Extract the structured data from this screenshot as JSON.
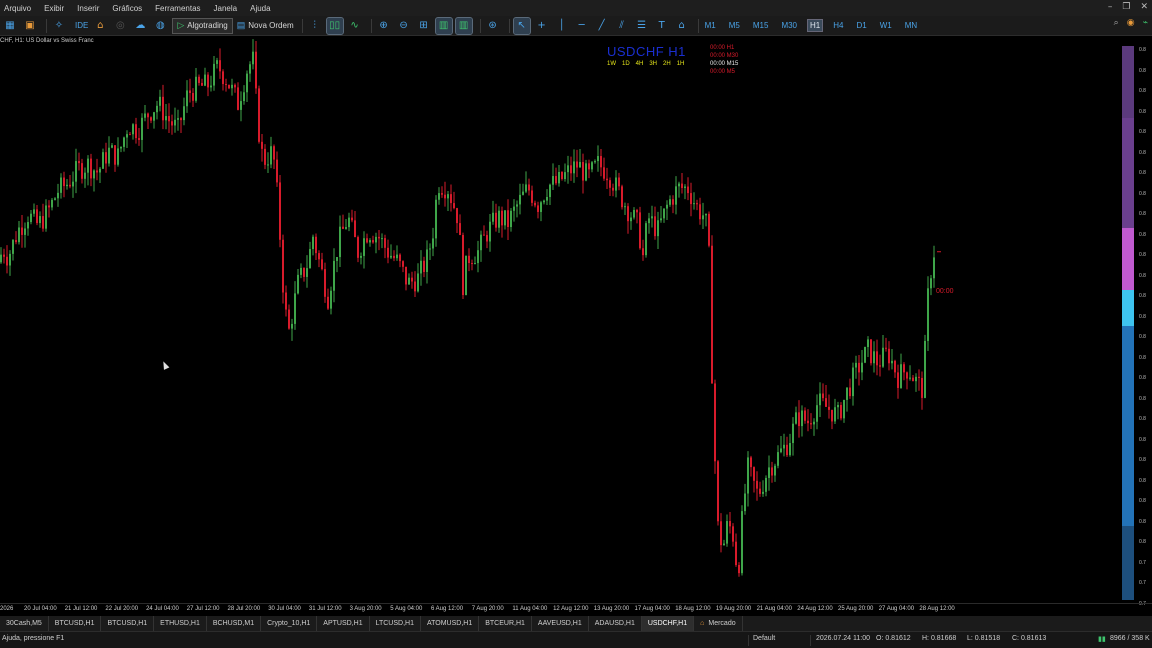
{
  "menu": [
    "Arquivo",
    "Exibir",
    "Inserir",
    "Gráficos",
    "Ferramentas",
    "Janela",
    "Ajuda"
  ],
  "toolbar": {
    "ide_label": "IDE",
    "algotrading_label": "Algotrading",
    "new_order_label": "Nova Ordem"
  },
  "timeframes": [
    "M1",
    "M5",
    "M15",
    "M30",
    "H1",
    "H4",
    "D1",
    "W1",
    "MN"
  ],
  "active_timeframe": "H1",
  "chart": {
    "title": "CHF, H1:  US Dollar vs Swiss Franc",
    "symbol_label": "USDCHF H1",
    "tf_buttons": [
      "1W",
      "1D",
      "4H",
      "3H",
      "2H",
      "1H"
    ],
    "timers": [
      {
        "text": "00:00 H1",
        "color": "#d81b2b"
      },
      {
        "text": "00:00 M30",
        "color": "#d81b2b"
      },
      {
        "text": "00:00 M15",
        "color": "#e8e8e8"
      },
      {
        "text": "00:00 M5",
        "color": "#d81b2b"
      }
    ],
    "price_tag": "00:00",
    "bull_color": "#3fa64a",
    "bear_color": "#d81b2b"
  },
  "chart_data": {
    "type": "candlestick",
    "x_labels": [
      "2026",
      "20 Jul 04:00",
      "21 Jul 12:00",
      "22 Jul 20:00",
      "24 Jul 04:00",
      "27 Jul 12:00",
      "28 Jul 20:00",
      "30 Jul 04:00",
      "31 Jul 12:00",
      "3 Aug 20:00",
      "5 Aug 04:00",
      "6 Aug 12:00",
      "7 Aug 20:00",
      "11 Aug 04:00",
      "12 Aug 12:00",
      "13 Aug 20:00",
      "17 Aug 04:00",
      "18 Aug 12:00",
      "19 Aug 20:00",
      "21 Aug 04:00",
      "24 Aug 12:00",
      "25 Aug 20:00",
      "27 Aug 04:00",
      "28 Aug 12:00"
    ],
    "y_tick_labels": [
      "0.8",
      "0.8",
      "0.8",
      "0.8",
      "0.8",
      "0.8",
      "0.8",
      "0.8",
      "0.8",
      "0.8",
      "0.8",
      "0.8",
      "0.8",
      "0.8",
      "0.8",
      "0.8",
      "0.8",
      "0.8",
      "0.8",
      "0.8",
      "0.8",
      "0.8",
      "0.8",
      "0.8",
      "0.8",
      "0.7",
      "0.7",
      "0.7"
    ],
    "trend": [
      [
        0,
        0.8158
      ],
      [
        5,
        0.8163
      ],
      [
        10,
        0.816
      ],
      [
        20,
        0.817
      ],
      [
        30,
        0.8176
      ],
      [
        40,
        0.8172
      ],
      [
        50,
        0.8177
      ],
      [
        60,
        0.8185
      ],
      [
        70,
        0.8188
      ],
      [
        80,
        0.8193
      ],
      [
        90,
        0.8195
      ],
      [
        100,
        0.8192
      ],
      [
        110,
        0.82
      ],
      [
        120,
        0.8198
      ],
      [
        130,
        0.821
      ],
      [
        140,
        0.8208
      ],
      [
        150,
        0.8214
      ],
      [
        160,
        0.8218
      ],
      [
        170,
        0.8212
      ],
      [
        180,
        0.8208
      ],
      [
        190,
        0.8222
      ],
      [
        200,
        0.8224
      ],
      [
        210,
        0.8225
      ],
      [
        220,
        0.8232
      ],
      [
        230,
        0.8226
      ],
      [
        240,
        0.8218
      ],
      [
        250,
        0.8232
      ],
      [
        255,
        0.8234
      ],
      [
        260,
        0.821
      ],
      [
        265,
        0.8196
      ],
      [
        275,
        0.82
      ],
      [
        280,
        0.818
      ],
      [
        285,
        0.815
      ],
      [
        290,
        0.813
      ],
      [
        295,
        0.814
      ],
      [
        300,
        0.815
      ],
      [
        310,
        0.8158
      ],
      [
        315,
        0.8168
      ],
      [
        320,
        0.816
      ],
      [
        330,
        0.8145
      ],
      [
        340,
        0.8165
      ],
      [
        350,
        0.8175
      ],
      [
        360,
        0.8162
      ],
      [
        370,
        0.817
      ],
      [
        380,
        0.8168
      ],
      [
        390,
        0.8162
      ],
      [
        400,
        0.8158
      ],
      [
        410,
        0.815
      ],
      [
        420,
        0.8152
      ],
      [
        430,
        0.816
      ],
      [
        435,
        0.817
      ],
      [
        440,
        0.8188
      ],
      [
        450,
        0.8186
      ],
      [
        460,
        0.8175
      ],
      [
        465,
        0.815
      ],
      [
        470,
        0.816
      ],
      [
        480,
        0.8162
      ],
      [
        490,
        0.817
      ],
      [
        500,
        0.8175
      ],
      [
        510,
        0.8173
      ],
      [
        520,
        0.818
      ],
      [
        530,
        0.8186
      ],
      [
        540,
        0.818
      ],
      [
        550,
        0.8187
      ],
      [
        560,
        0.8188
      ],
      [
        570,
        0.8192
      ],
      [
        580,
        0.8195
      ],
      [
        590,
        0.819
      ],
      [
        600,
        0.8195
      ],
      [
        610,
        0.8192
      ],
      [
        620,
        0.8185
      ],
      [
        630,
        0.8178
      ],
      [
        640,
        0.8172
      ],
      [
        645,
        0.816
      ],
      [
        650,
        0.8175
      ],
      [
        660,
        0.817
      ],
      [
        670,
        0.818
      ],
      [
        680,
        0.8186
      ],
      [
        690,
        0.8186
      ],
      [
        700,
        0.8178
      ],
      [
        705,
        0.8176
      ],
      [
        710,
        0.817
      ],
      [
        712,
        0.815
      ],
      [
        715,
        0.81
      ],
      [
        720,
        0.8058
      ],
      [
        725,
        0.805
      ],
      [
        730,
        0.806
      ],
      [
        735,
        0.8055
      ],
      [
        740,
        0.804
      ],
      [
        745,
        0.8065
      ],
      [
        750,
        0.808
      ],
      [
        760,
        0.807
      ],
      [
        770,
        0.808
      ],
      [
        780,
        0.8085
      ],
      [
        790,
        0.809
      ],
      [
        800,
        0.81
      ],
      [
        810,
        0.8098
      ],
      [
        820,
        0.8105
      ],
      [
        830,
        0.8103
      ],
      [
        840,
        0.81
      ],
      [
        850,
        0.811
      ],
      [
        860,
        0.8118
      ],
      [
        870,
        0.8125
      ],
      [
        880,
        0.812
      ],
      [
        890,
        0.8124
      ],
      [
        900,
        0.8115
      ],
      [
        910,
        0.8118
      ],
      [
        920,
        0.8112
      ],
      [
        925,
        0.811
      ],
      [
        930,
        0.8145
      ],
      [
        935,
        0.8162
      ]
    ]
  },
  "tabs": [
    "30Cash,M5",
    "BTCUSD,H1",
    "BTCUSD,H1",
    "ETHUSD,H1",
    "BCHUSD,M1",
    "Crypto_10,H1",
    "APTUSD,H1",
    "LTCUSD,H1",
    "ATOMUSD,H1",
    "BTCEUR,H1",
    "AAVEUSD,H1",
    "ADAUSD,H1",
    "USDCHF,H1"
  ],
  "active_tab": "USDCHF,H1",
  "market_tab": "Mercado",
  "status": {
    "help": "Ajuda, pressione F1",
    "profile": "Default",
    "datetime": "2026.07.24 11:00",
    "open": "O: 0.81612",
    "high": "H: 0.81668",
    "low": "L: 0.81518",
    "close": "C: 0.81613",
    "traffic": "8966 / 358 K"
  }
}
